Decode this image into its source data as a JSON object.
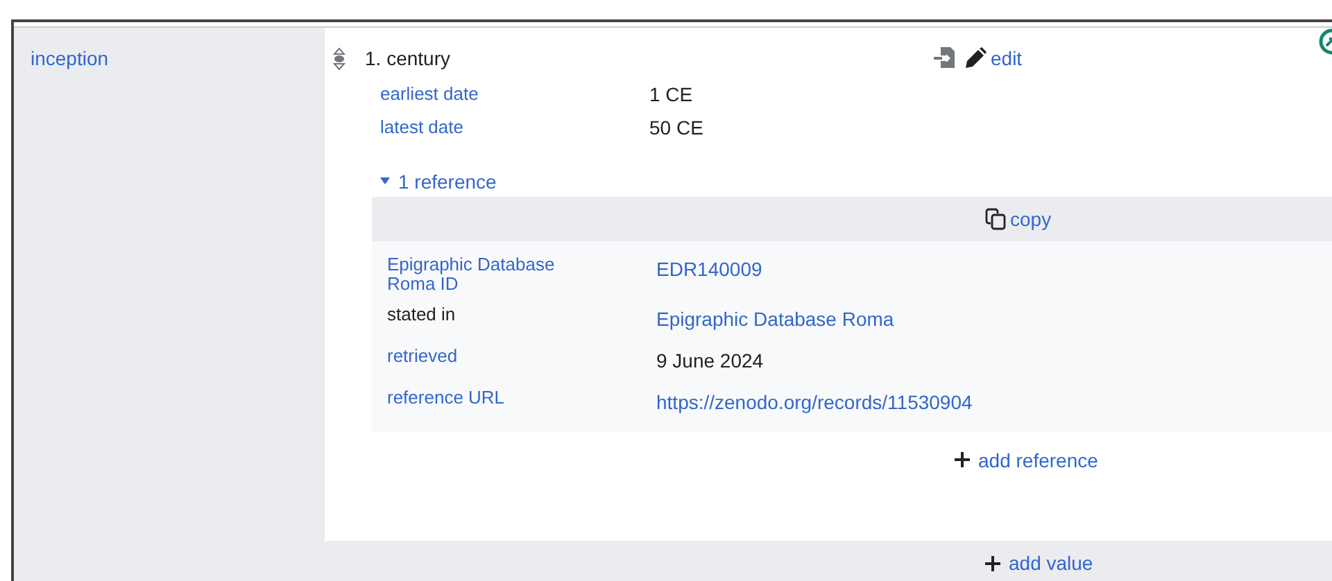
{
  "property": {
    "label": "inception"
  },
  "statement": {
    "value": "1. century",
    "edit": "edit",
    "qualifiers": [
      {
        "label": "earliest date",
        "value": "1 CE"
      },
      {
        "label": "latest date",
        "value": "50 CE"
      }
    ],
    "references": {
      "toggle": "1 reference",
      "expanded": true,
      "copy": "copy",
      "snaks": [
        {
          "label": "Epigraphic Database Roma ID",
          "label_link": true,
          "value": "EDR140009",
          "value_link": true
        },
        {
          "label": "stated in",
          "label_link": false,
          "value": "Epigraphic Database Roma",
          "value_link": true
        },
        {
          "label": "retrieved",
          "label_link": true,
          "value": "9 June 2024",
          "value_link": false
        },
        {
          "label": "reference URL",
          "label_link": true,
          "value": "https://zenodo.org/records/11530904",
          "value_link": true
        }
      ],
      "add": "add reference"
    }
  },
  "add_value": "add value"
}
